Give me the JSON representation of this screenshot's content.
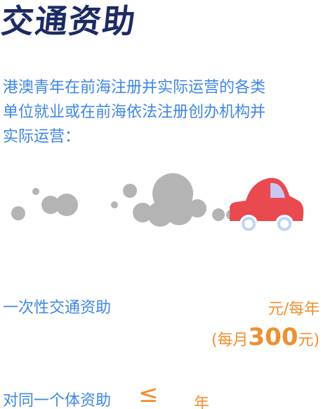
{
  "title": "交通资助",
  "intro_text": "港澳青年在前海注册并实际运营的各类\n单位就业或在前海依法注册创办机构并\n实际运营：",
  "illustration": {
    "icons": [
      "exhaust-cloud-icon",
      "car-icon"
    ],
    "colors": {
      "cloud": "#b4b4b4",
      "car_body": "#e84a4f",
      "car_window": "#c9c6f2",
      "wheel_rim": "#bcd5f2"
    }
  },
  "subsidy_1": {
    "label": "一次性交通资助",
    "unit": "元/每年",
    "monthly_prefix": "(每月",
    "monthly_amount": "300",
    "monthly_suffix": "元)"
  },
  "subsidy_2": {
    "label": "对同一个体资助",
    "operator": "≤",
    "unit": "年"
  },
  "colors": {
    "title": "#1d2a63",
    "body_blue": "#3f86e3",
    "accent_orange": "#ef8f2f"
  }
}
